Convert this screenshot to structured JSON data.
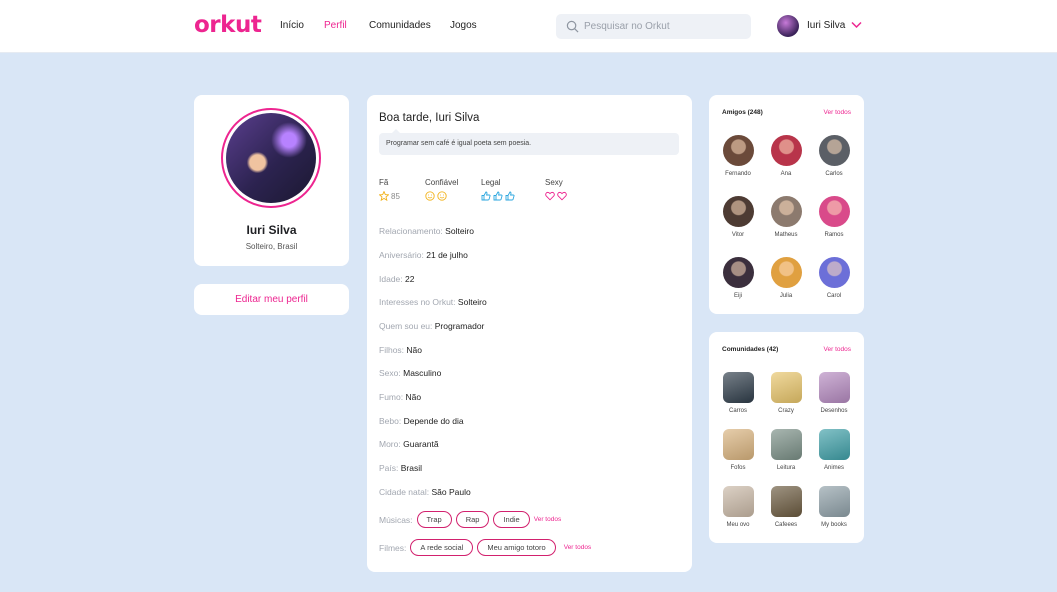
{
  "header": {
    "logo": "orkut",
    "nav": [
      "Início",
      "Perfil",
      "Comunidades",
      "Jogos"
    ],
    "active_nav": "Perfil",
    "search_placeholder": "Pesquisar no Orkut",
    "user_name": "Iuri Silva"
  },
  "profile": {
    "name": "Iuri Silva",
    "status": "Solteiro, Brasil",
    "edit_label": "Editar meu perfil"
  },
  "main": {
    "greeting": "Boa tarde, Iuri Silva",
    "quote": "Programar sem café é igual poeta sem poesia.",
    "ratings": {
      "fa": {
        "label": "Fã",
        "count": "85"
      },
      "confiavel": {
        "label": "Confiável",
        "level": 2
      },
      "legal": {
        "label": "Legal",
        "level": 3
      },
      "sexy": {
        "label": "Sexy",
        "level": 2
      }
    },
    "info": [
      {
        "label": "Relacionamento:",
        "value": "Solteiro"
      },
      {
        "label": "Aniversário:",
        "value": "21 de julho"
      },
      {
        "label": "Idade:",
        "value": "22"
      },
      {
        "label": "Interesses no Orkut:",
        "value": "Solteiro"
      },
      {
        "label": "Quem sou eu:",
        "value": "Programador"
      },
      {
        "label": "Filhos:",
        "value": "Não"
      },
      {
        "label": "Sexo:",
        "value": "Masculino"
      },
      {
        "label": "Fumo:",
        "value": "Não"
      },
      {
        "label": "Bebo:",
        "value": "Depende do dia"
      },
      {
        "label": "Moro:",
        "value": "Guarantã"
      },
      {
        "label": "País:",
        "value": "Brasil"
      },
      {
        "label": "Cidade natal:",
        "value": "São Paulo"
      }
    ],
    "musicas_label": "Músicas:",
    "musicas": [
      "Trap",
      "Rap",
      "Indie"
    ],
    "filmes_label": "Filmes:",
    "filmes": [
      "A rede social",
      "Meu amigo totoro"
    ],
    "see_all": "Ver todos"
  },
  "friends": {
    "title": "Amigos (248)",
    "see_all": "Ver todos",
    "items": [
      {
        "name": "Fernando",
        "color": "#6b4a3a"
      },
      {
        "name": "Ana",
        "color": "#b8344a"
      },
      {
        "name": "Carlos",
        "color": "#5b5f66"
      },
      {
        "name": "Vitor",
        "color": "#4d3b33"
      },
      {
        "name": "Matheus",
        "color": "#8c7a6e"
      },
      {
        "name": "Ramos",
        "color": "#d94a8a"
      },
      {
        "name": "Eiji",
        "color": "#3b2f3d"
      },
      {
        "name": "Julia",
        "color": "#e0a040"
      },
      {
        "name": "Carol",
        "color": "#6c6fd8"
      }
    ]
  },
  "communities": {
    "title": "Comunidades (42)",
    "see_all": "Ver todos",
    "items": [
      {
        "name": "Carros",
        "color": "#2f3d4a"
      },
      {
        "name": "Crazy",
        "color": "#e8c56a"
      },
      {
        "name": "Desenhos",
        "color": "#b58ac0"
      },
      {
        "name": "Fofos",
        "color": "#d9b37e"
      },
      {
        "name": "Leitura",
        "color": "#7a8f86"
      },
      {
        "name": "Animes",
        "color": "#3fa0a8"
      },
      {
        "name": "Meu ovo",
        "color": "#c9b8a6"
      },
      {
        "name": "Cafeees",
        "color": "#6b5a3f"
      },
      {
        "name": "My books",
        "color": "#8fa0a8"
      }
    ]
  }
}
